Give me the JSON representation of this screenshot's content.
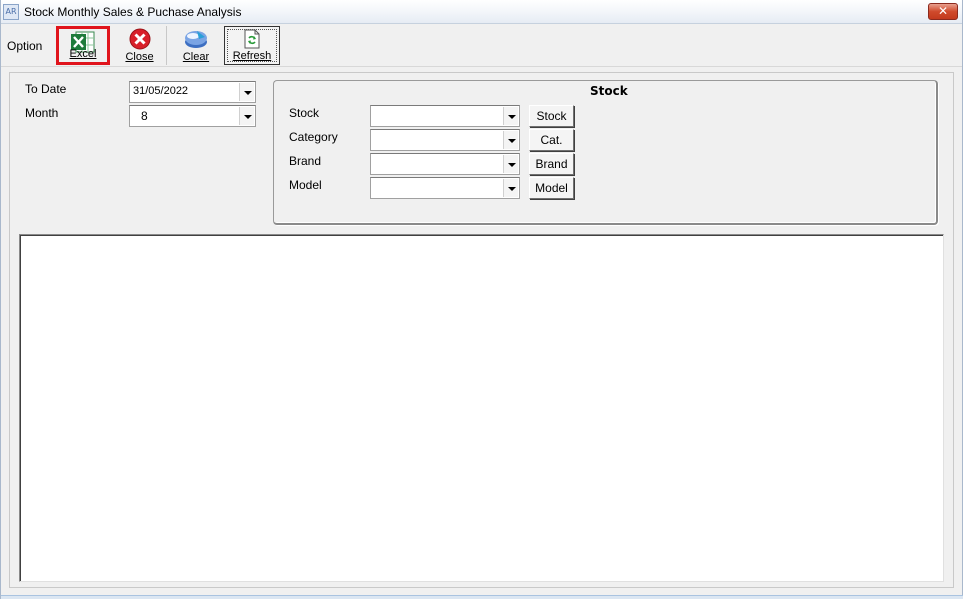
{
  "window": {
    "title": "Stock Monthly Sales & Puchase Analysis",
    "icon_text": "AR",
    "close_glyph": "✕"
  },
  "toolbar": {
    "option_label": "Option",
    "excel_label": "Excel",
    "close_label": "Close",
    "clear_label": "Clear",
    "refresh_label": "Refresh"
  },
  "form": {
    "to_date_label": "To Date",
    "to_date_value": "31/05/2022",
    "month_label": "Month",
    "month_value": "8"
  },
  "stock_group": {
    "title": "Stock",
    "stock_label": "Stock",
    "category_label": "Category",
    "brand_label": "Brand",
    "model_label": "Model",
    "stock_value": "",
    "category_value": "",
    "brand_value": "",
    "model_value": "",
    "stock_button": "Stock",
    "category_button": "Cat.",
    "brand_button": "Brand",
    "model_button": "Model"
  },
  "colors": {
    "highlight_border": "#e0141c",
    "excel_green": "#1e7b3a",
    "close_red": "#d8202a"
  }
}
